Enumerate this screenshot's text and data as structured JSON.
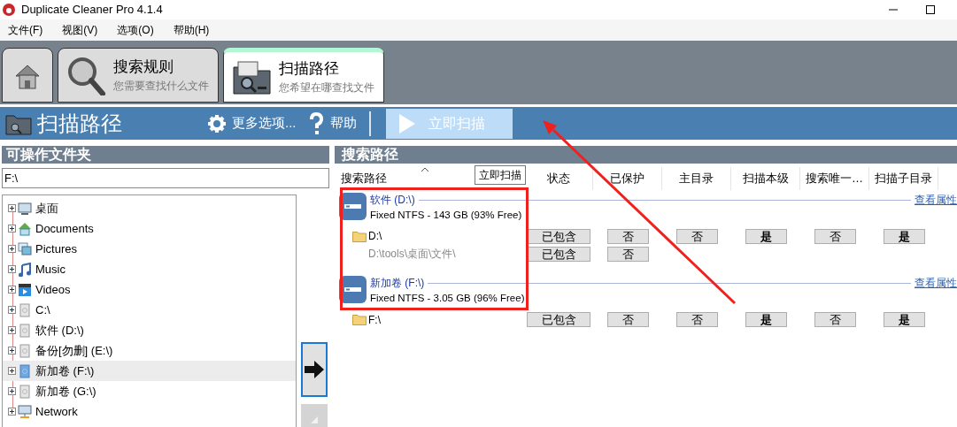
{
  "window": {
    "title": "Duplicate Cleaner Pro 4.1.4"
  },
  "menu": [
    "文件(F)",
    "视图(V)",
    "选项(O)",
    "帮助(H)"
  ],
  "tabs": [
    {
      "kind": "home",
      "selected": false
    },
    {
      "kind": "search",
      "title": "搜索规则",
      "subtitle": "您需要查找什么文件",
      "selected": false
    },
    {
      "kind": "folder",
      "title": "扫描路径",
      "subtitle": "您希望在哪查找文件",
      "selected": true
    }
  ],
  "toolbar": {
    "title": "扫描路径",
    "more_options": "更多选项...",
    "help": "帮助",
    "scan_button": "立即扫描"
  },
  "left_panel": {
    "header": "可操作文件夹",
    "path": "F:\\",
    "tree": [
      {
        "label": "桌面",
        "kind": "desktop",
        "expanded": false,
        "selected": false
      },
      {
        "label": "Documents",
        "kind": "documents",
        "expanded": false,
        "selected": false
      },
      {
        "label": "Pictures",
        "kind": "pictures",
        "expanded": false,
        "selected": false
      },
      {
        "label": "Music",
        "kind": "music",
        "expanded": false,
        "selected": false
      },
      {
        "label": "Videos",
        "kind": "videos",
        "expanded": false,
        "selected": false
      },
      {
        "label": "C:\\",
        "kind": "drive",
        "expanded": false,
        "selected": false
      },
      {
        "label": "软件 (D:\\)",
        "kind": "drive",
        "expanded": false,
        "selected": false
      },
      {
        "label": "备份[勿删] (E:\\)",
        "kind": "drive",
        "expanded": false,
        "selected": false
      },
      {
        "label": "新加卷 (F:\\)",
        "kind": "drive",
        "expanded": false,
        "selected": true
      },
      {
        "label": "新加卷 (G:\\)",
        "kind": "drive",
        "expanded": false,
        "selected": false
      },
      {
        "label": "Network",
        "kind": "network",
        "expanded": false,
        "selected": false
      }
    ]
  },
  "right_panel": {
    "header": "搜索路径",
    "columns": [
      "搜索路径",
      "状态",
      "已保护",
      "主目录",
      "扫描本级",
      "搜索唯一…",
      "扫描子目录"
    ],
    "tooltip": "立即扫描",
    "drives": [
      {
        "name": "软件 (D:\\)",
        "info": "Fixed NTFS - 143 GB (93% Free)",
        "link": "查看属性",
        "paths": [
          {
            "path": "D:\\",
            "kind": "folder",
            "cells": [
              {
                "text": "已包含",
                "bold": false
              },
              {
                "text": "否",
                "bold": false
              },
              {
                "text": "否",
                "bold": false
              },
              {
                "text": "是",
                "bold": true
              },
              {
                "text": "否",
                "bold": false
              },
              {
                "text": "是",
                "bold": true
              }
            ]
          },
          {
            "path": "D:\\tools\\桌面\\文件\\",
            "kind": "subfolder",
            "cells": [
              {
                "text": "已包含",
                "bold": false
              },
              {
                "text": "否",
                "bold": false
              }
            ]
          }
        ]
      },
      {
        "name": "新加卷 (F:\\)",
        "info": "Fixed NTFS - 3.05 GB (96% Free)",
        "link": "查看属性",
        "paths": [
          {
            "path": "F:\\",
            "kind": "folder",
            "cells": [
              {
                "text": "已包含",
                "bold": false
              },
              {
                "text": "否",
                "bold": false
              },
              {
                "text": "否",
                "bold": false
              },
              {
                "text": "是",
                "bold": true
              },
              {
                "text": "否",
                "bold": false
              },
              {
                "text": "是",
                "bold": true
              }
            ]
          }
        ]
      }
    ]
  }
}
